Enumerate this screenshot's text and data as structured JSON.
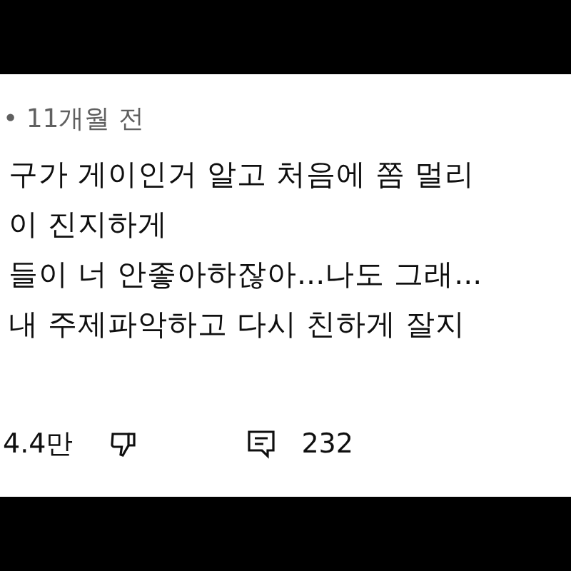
{
  "comment": {
    "meta": "• 11개월 전",
    "lines": [
      "구가 게이인거 알고 처음에 쫌 멀리",
      "이 진지하게",
      "들이 너 안좋아하잖아...나도 그래...",
      "내 주제파악하고 다시 친하게 잘지"
    ]
  },
  "actions": {
    "likes": "4.4만",
    "replies": "232"
  }
}
